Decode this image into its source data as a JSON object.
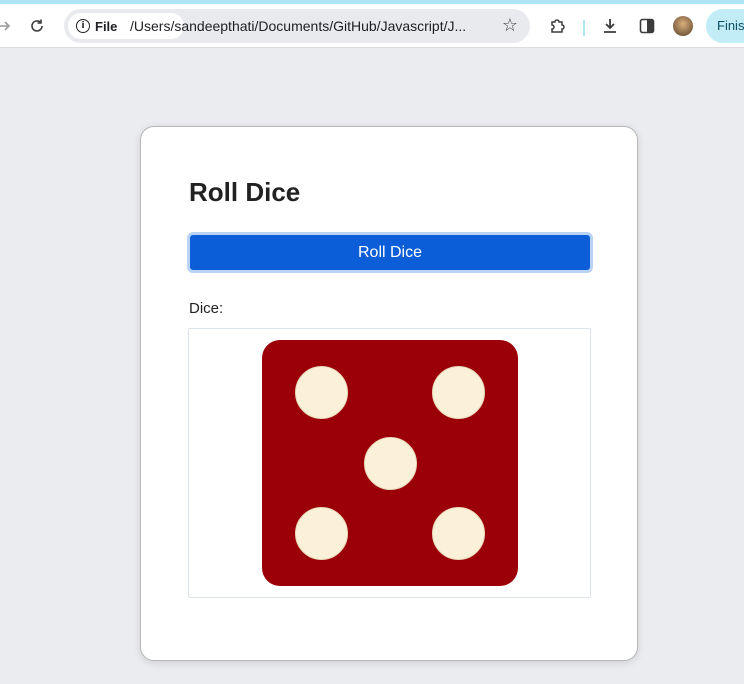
{
  "browser": {
    "chip_label": "File",
    "url": "/Users/sandeepthati/Documents/GitHub/Javascript/J...",
    "profile_button_label": "Finis"
  },
  "app": {
    "title": "Roll Dice",
    "button_label": "Roll Dice",
    "dice_label": "Dice:",
    "dice_value": 5,
    "die_color": "#9b0008",
    "pip_color": "#fbf0d8",
    "button_color": "#0c5ed8"
  }
}
